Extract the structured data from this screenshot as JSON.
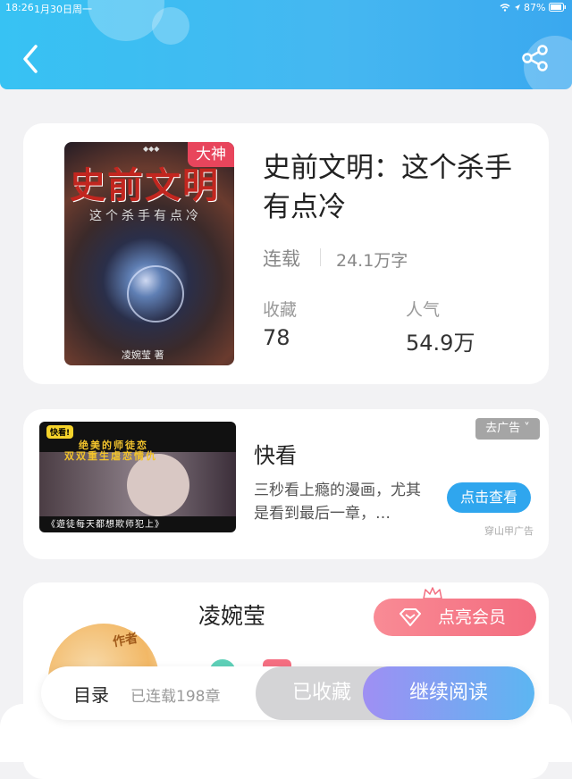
{
  "status_bar": {
    "time": "18:26",
    "date": "1月30日周一",
    "battery": "87%"
  },
  "book": {
    "cover_title": "史前文明",
    "cover_subtitle": "这个杀手有点冷",
    "cover_author": "凌婉莹 著",
    "badge": "大神",
    "title": "史前文明：这个杀手有点冷",
    "status": "连载",
    "word_count": "24.1万字",
    "stats": [
      {
        "label": "收藏",
        "value": "78"
      },
      {
        "label": "人气",
        "value": "54.9万"
      }
    ]
  },
  "ad": {
    "title": "快看",
    "description": "三秒看上瘾的漫画，尤其是看到最后一章，…",
    "button": "点击查看",
    "close_label": "去广告 ˅",
    "source": "穿山甲广告",
    "image_logo": "快看!",
    "image_line1": "绝美的师徒恋",
    "image_line2": "双双重生虐恋情仇",
    "image_line3": "《遊徒每天都想欺师犯上》"
  },
  "author": {
    "name": "凌婉莹",
    "tag": "作者",
    "vip_button": "点亮会员"
  },
  "bottom_bar": {
    "toc": "目录",
    "chapters": "已连载198章",
    "collected": "已收藏",
    "continue": "继续阅读"
  },
  "colors": {
    "header": "#45b7f1",
    "badge": "#e8455c",
    "ad_button": "#2fa6ee",
    "vip_button": "#f36c7f"
  }
}
